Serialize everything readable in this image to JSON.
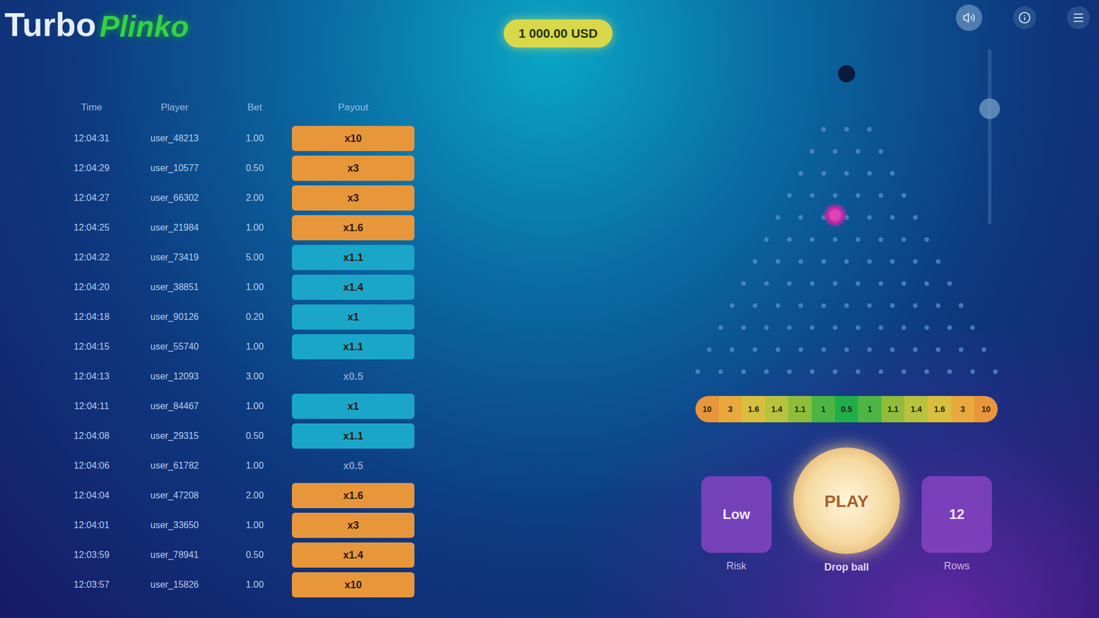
{
  "logo": {
    "primary": "Turbo",
    "accent": "Plinko"
  },
  "balance": "1 000.00 USD",
  "top_icons": [
    {
      "name": "sound"
    },
    {
      "name": "info"
    },
    {
      "name": "menu"
    }
  ],
  "bet_slider": {
    "level": 0.66
  },
  "history": {
    "columns": [
      "Time",
      "Player",
      "Bet",
      "Payout"
    ],
    "rows": [
      {
        "time": "12:04:31",
        "player": "user_48213",
        "bet": "1.00",
        "payout": "x10",
        "color": "#e8963a"
      },
      {
        "time": "12:04:29",
        "player": "user_10577",
        "bet": "0.50",
        "payout": "x3",
        "color": "#e8963a"
      },
      {
        "time": "12:04:27",
        "player": "user_66302",
        "bet": "2.00",
        "payout": "x3",
        "color": "#e8963a"
      },
      {
        "time": "12:04:25",
        "player": "user_21984",
        "bet": "1.00",
        "payout": "x1.6",
        "color": "#e8963a"
      },
      {
        "time": "12:04:22",
        "player": "user_73419",
        "bet": "5.00",
        "payout": "x1.1",
        "color": "#1aa6c9"
      },
      {
        "time": "12:04:20",
        "player": "user_38851",
        "bet": "1.00",
        "payout": "x1.4",
        "color": "#1aa6c9"
      },
      {
        "time": "12:04:18",
        "player": "user_90126",
        "bet": "0.20",
        "payout": "x1",
        "color": "#1aa6c9"
      },
      {
        "time": "12:04:15",
        "player": "user_55740",
        "bet": "1.00",
        "payout": "x1.1",
        "color": "#1aa6c9"
      },
      {
        "time": "12:04:13",
        "player": "user_12093",
        "bet": "3.00",
        "payout": "x0.5",
        "color": ""
      },
      {
        "time": "12:04:11",
        "player": "user_84467",
        "bet": "1.00",
        "payout": "x1",
        "color": "#1aa6c9"
      },
      {
        "time": "12:04:08",
        "player": "user_29315",
        "bet": "0.50",
        "payout": "x1.1",
        "color": "#1aa6c9"
      },
      {
        "time": "12:04:06",
        "player": "user_61782",
        "bet": "1.00",
        "payout": "x0.5",
        "color": ""
      },
      {
        "time": "12:04:04",
        "player": "user_47208",
        "bet": "2.00",
        "payout": "x1.6",
        "color": "#e8963a"
      },
      {
        "time": "12:04:01",
        "player": "user_33650",
        "bet": "1.00",
        "payout": "x3",
        "color": "#e8963a"
      },
      {
        "time": "12:03:59",
        "player": "user_78941",
        "bet": "0.50",
        "payout": "x1.4",
        "color": "#e8963a"
      },
      {
        "time": "12:03:57",
        "player": "user_15826",
        "bet": "1.00",
        "payout": "x10",
        "color": "#e8963a"
      }
    ]
  },
  "board": {
    "rows": 12,
    "ball_row": 4,
    "ball_offset": -0.5
  },
  "buckets": [
    {
      "multiplier": "10",
      "color": "#e8963a"
    },
    {
      "multiplier": "3",
      "color": "#e9a93c"
    },
    {
      "multiplier": "1.6",
      "color": "#d9bf3e"
    },
    {
      "multiplier": "1.4",
      "color": "#b9c23c"
    },
    {
      "multiplier": "1.1",
      "color": "#8fbd3a"
    },
    {
      "multiplier": "1",
      "color": "#4db543"
    },
    {
      "multiplier": "0.5",
      "color": "#1fae4a"
    },
    {
      "multiplier": "1",
      "color": "#4db543"
    },
    {
      "multiplier": "1.1",
      "color": "#8fbd3a"
    },
    {
      "multiplier": "1.4",
      "color": "#b9c23c"
    },
    {
      "multiplier": "1.6",
      "color": "#d9bf3e"
    },
    {
      "multiplier": "3",
      "color": "#e9a93c"
    },
    {
      "multiplier": "10",
      "color": "#e8963a"
    }
  ],
  "controls": {
    "left": {
      "value": "Low",
      "label": "Risk"
    },
    "play": {
      "value": "PLAY",
      "label": "Drop ball"
    },
    "right": {
      "value": "12",
      "label": "Rows"
    }
  }
}
